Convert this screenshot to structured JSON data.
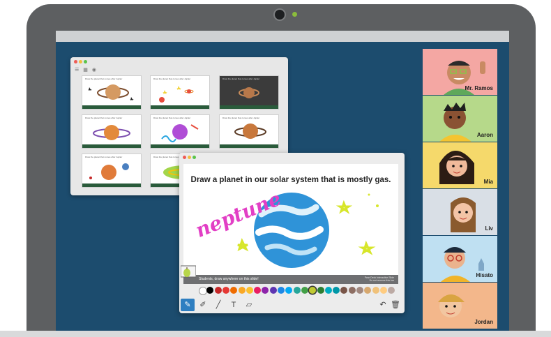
{
  "laptop": {
    "camera_icon": "webcam-icon"
  },
  "slide_sorter": {
    "toolbar_icons": [
      "list-view-icon",
      "grid-view-icon",
      "eye-icon"
    ],
    "thumb_caption": "Draw the planet that comes after Jupiter"
  },
  "main_window": {
    "slide_title": "Draw a planet in our solar system that is mostly gas.",
    "handwritten_text": "neptune",
    "footer_text": "Students, draw anywhere on this slide!",
    "footer_brand": [
      "Pear Deck Interactive Slide",
      "Do not remove this bar"
    ],
    "palette": [
      "#ffffff",
      "#000000",
      "#c62828",
      "#e53935",
      "#ef6c00",
      "#f9a825",
      "#fbc02d",
      "#e91e63",
      "#8e24aa",
      "#5e35b1",
      "#1e88e5",
      "#03a9f4",
      "#26a69a",
      "#43a047",
      "#c0ca33",
      "#2e7d32",
      "#00acc1",
      "#0097a7",
      "#795548",
      "#8d6e63",
      "#a1887f",
      "#d7a86e",
      "#f0c27b",
      "#ffcc80",
      "#bcaaa4"
    ],
    "tools": [
      "pen-icon",
      "pencil-icon",
      "line-icon",
      "text-icon",
      "eraser-icon"
    ],
    "tools_right": [
      "undo-icon",
      "trash-icon"
    ]
  },
  "participants": [
    {
      "name": "Mr. Ramos",
      "bg": "#f4a7a3"
    },
    {
      "name": "Aaron",
      "bg": "#b6d98a"
    },
    {
      "name": "Mia",
      "bg": "#f5d96b"
    },
    {
      "name": "Liv",
      "bg": "#d9dfe6"
    },
    {
      "name": "Hisato",
      "bg": "#bfe0f2"
    },
    {
      "name": "Jordan",
      "bg": "#f3b78b"
    }
  ]
}
